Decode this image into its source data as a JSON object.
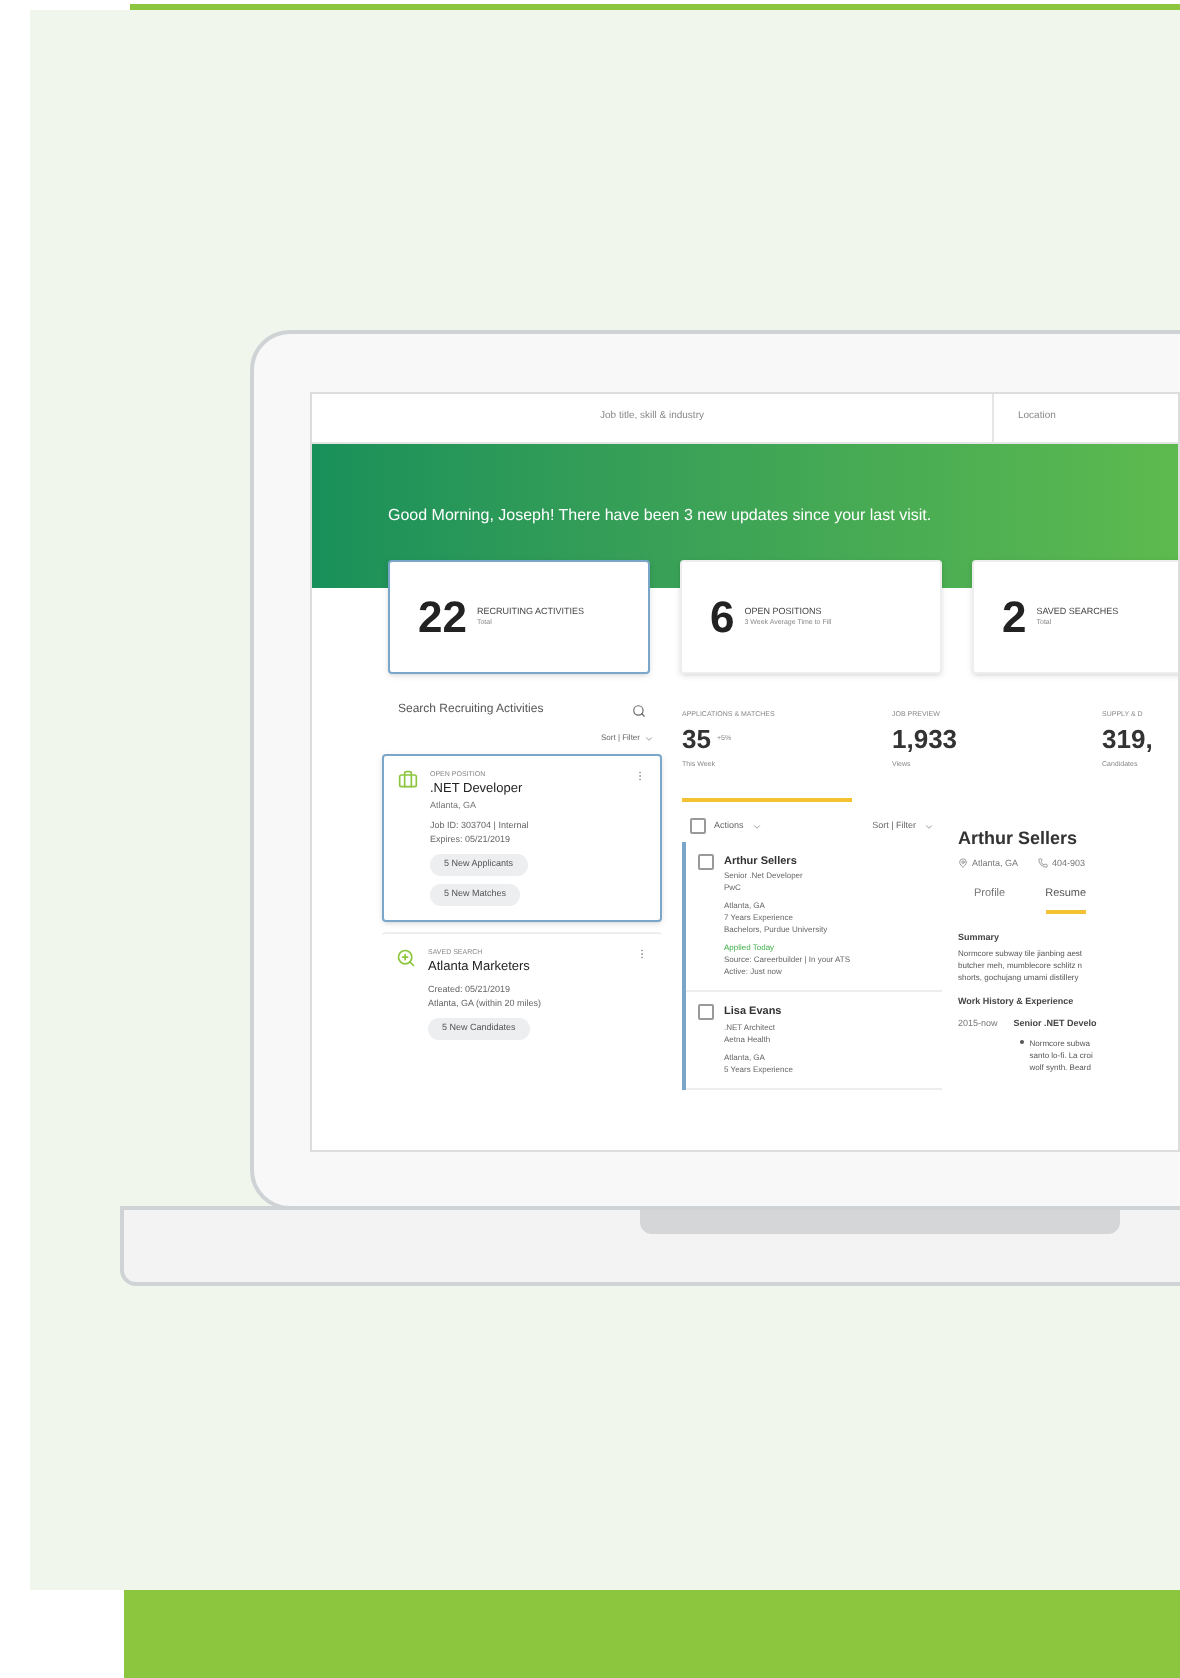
{
  "search": {
    "placeholder": "Job title, skill & industry",
    "location_placeholder": "Location"
  },
  "banner": {
    "greeting": "Good Morning, Joseph! There have been 3 new updates since your last visit."
  },
  "summary_cards": [
    {
      "value": "22",
      "label": "RECRUITING ACTIVITIES",
      "sub": "Total",
      "selected": true
    },
    {
      "value": "6",
      "label": "OPEN POSITIONS",
      "sub": "3 Week Average Time to Fill",
      "selected": false
    },
    {
      "value": "2",
      "label": "SAVED SEARCHES",
      "sub": "Total",
      "selected": false
    }
  ],
  "activities_panel": {
    "title": "Search Recruiting Activities",
    "sort_filter": "Sort | Filter",
    "items": [
      {
        "kind": "position",
        "type_label": "OPEN POSITION",
        "title": ".NET Developer",
        "lines": [
          "Atlanta, GA"
        ],
        "details": [
          "Job ID: 303704 | Internal",
          "Expires: 05/21/2019"
        ],
        "tags": [
          "5 New Applicants",
          "5 New Matches"
        ],
        "selected": true
      },
      {
        "kind": "search",
        "type_label": "SAVED SEARCH",
        "title": "Atlanta Marketers",
        "details": [
          "Created: 05/21/2019",
          "Atlanta, GA (within 20 miles)"
        ],
        "tags": [
          "5 New Candidates"
        ],
        "selected": false
      }
    ]
  },
  "stats": [
    {
      "label": "APPLICATIONS & MATCHES",
      "value": "35",
      "change": "+5%",
      "sub": "This Week",
      "selected": true
    },
    {
      "label": "JOB PREVIEW",
      "value": "1,933",
      "sub": "Views",
      "selected": false
    },
    {
      "label": "SUPPLY & D",
      "value": "319,",
      "sub": "Candidates",
      "selected": false
    }
  ],
  "candidates_list": {
    "select_all_checked": false,
    "actions": "Actions",
    "sort_filter": "Sort | Filter",
    "candidates": [
      {
        "name": "Arthur Sellers",
        "lines": [
          "Senior .Net Developer",
          "PwC"
        ],
        "details": [
          "Atlanta, GA",
          "7 Years Experience",
          "Bachelors, Purdue University"
        ],
        "status": "Applied Today",
        "meta": [
          "Source: Careerbuilder | In your ATS",
          "Active: Just now"
        ],
        "checked": false
      },
      {
        "name": "Lisa Evans",
        "lines": [
          ".NET Architect",
          "Aetna Health"
        ],
        "details": [
          "Atlanta, GA",
          "5 Years Experience"
        ],
        "checked": false
      }
    ]
  },
  "candidate_detail": {
    "name": "Arthur Sellers",
    "location": "Atlanta, GA",
    "phone": "404-903",
    "tabs": [
      {
        "label": "Profile",
        "selected": false
      },
      {
        "label": "Resume",
        "selected": true
      }
    ],
    "summary_heading": "Summary",
    "summary_lines": [
      "Normcore subway tile jianbing aest",
      "butcher meh, mumblecore schlitz n",
      "shorts, gochujang umami distillery"
    ],
    "work_heading": "Work History & Experience",
    "jobs": [
      {
        "period": "2015-now",
        "role": "Senior .NET Develo",
        "bullet_lines": [
          "Normcore subwa",
          "santo lo-fi. La croi",
          "wolf synth. Beard"
        ]
      }
    ]
  }
}
